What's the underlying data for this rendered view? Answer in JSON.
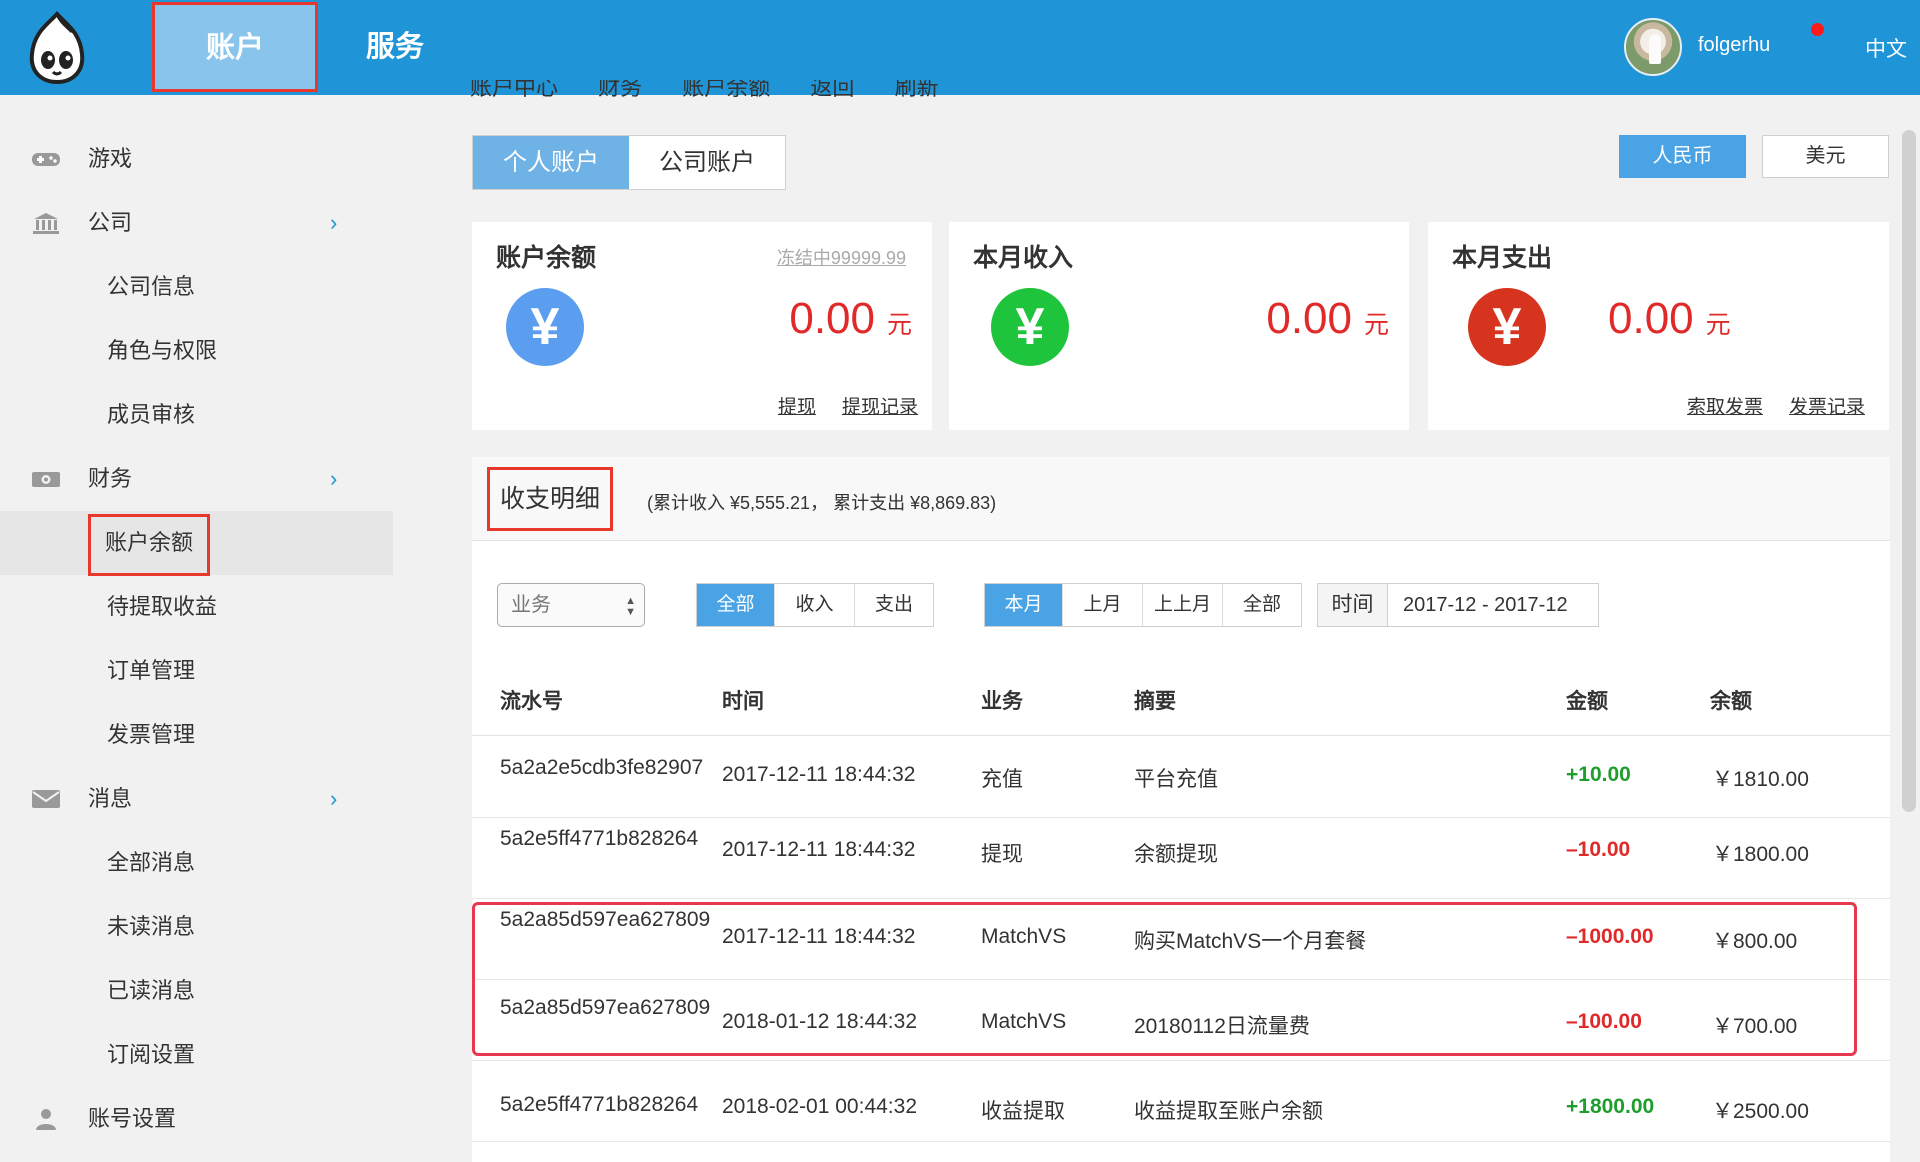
{
  "topbar": {
    "tab_account": "账户",
    "tab_service": "服务",
    "username": "folgerhu",
    "language": "中文"
  },
  "sidebar": {
    "items": [
      {
        "label": "游戏",
        "icon": "gamepad-icon"
      },
      {
        "label": "公司",
        "icon": "bank-icon"
      },
      {
        "label": "公司信息"
      },
      {
        "label": "角色与权限"
      },
      {
        "label": "成员审核"
      },
      {
        "label": "财务",
        "icon": "money-icon"
      },
      {
        "label": "账户余额"
      },
      {
        "label": "待提取收益"
      },
      {
        "label": "订单管理"
      },
      {
        "label": "发票管理"
      },
      {
        "label": "消息",
        "icon": "envelope-icon"
      },
      {
        "label": "全部消息"
      },
      {
        "label": "未读消息"
      },
      {
        "label": "已读消息"
      },
      {
        "label": "订阅设置"
      },
      {
        "label": "账号设置",
        "icon": "user-icon"
      }
    ],
    "chevron": "›"
  },
  "breadcrumb": [
    "账户中心",
    "财务",
    "账户余额",
    "返回",
    "刷新"
  ],
  "account_tabs": {
    "personal": "个人账户",
    "company": "公司账户"
  },
  "currency": {
    "rmb": "人民币",
    "usd": "美元"
  },
  "cards": {
    "balance": {
      "title": "账户余额",
      "frozen": "冻结中99999.99",
      "amount": "0.00",
      "unit": "元",
      "link1": "提现",
      "link2": "提现记录",
      "symbol": "¥",
      "color": "#5b9ef0"
    },
    "income": {
      "title": "本月收入",
      "amount": "0.00",
      "unit": "元",
      "symbol": "¥",
      "color": "#1ec43c"
    },
    "expense": {
      "title": "本月支出",
      "amount": "0.00",
      "unit": "元",
      "link1": "索取发票",
      "link2": "发票记录",
      "symbol": "¥",
      "color": "#d7341f"
    }
  },
  "detail": {
    "title": "收支明细",
    "totals": "(累计收入 ¥5,555.21， 累计支出 ¥8,869.83)",
    "business_select": "业务",
    "type_filter": [
      "全部",
      "收入",
      "支出"
    ],
    "period_filter": [
      "本月",
      "上月",
      "上上月",
      "全部"
    ],
    "time_label": "时间",
    "time_value": "2017-12 - 2017-12",
    "columns": [
      "流水号",
      "时间",
      "业务",
      "摘要",
      "金额",
      "余额"
    ],
    "rows": [
      {
        "id": "5a2a2e5cdb3fe82907",
        "time": "2017-12-11 18:44:32",
        "business": "充值",
        "summary": "平台充值",
        "amount": "+10.00",
        "balance": "￥1810.00"
      },
      {
        "id": "5a2e5ff4771b828264",
        "time": "2017-12-11 18:44:32",
        "business": "提现",
        "summary": "余额提现",
        "amount": "–10.00",
        "balance": "￥1800.00"
      },
      {
        "id": "5a2a85d597ea627809",
        "time": "2017-12-11 18:44:32",
        "business": "MatchVS",
        "summary": "购买MatchVS一个月套餐",
        "amount": "–1000.00",
        "balance": "￥800.00"
      },
      {
        "id": "5a2a85d597ea627809",
        "time": "2018-01-12 18:44:32",
        "business": "MatchVS",
        "summary": "20180112日流量费",
        "amount": "–100.00",
        "balance": "￥700.00"
      },
      {
        "id": "5a2e5ff4771b828264",
        "time": "2018-02-01 00:44:32",
        "business": "收益提取",
        "summary": "收益提取至账户余额",
        "amount": "+1800.00",
        "balance": "￥2500.00"
      }
    ]
  }
}
